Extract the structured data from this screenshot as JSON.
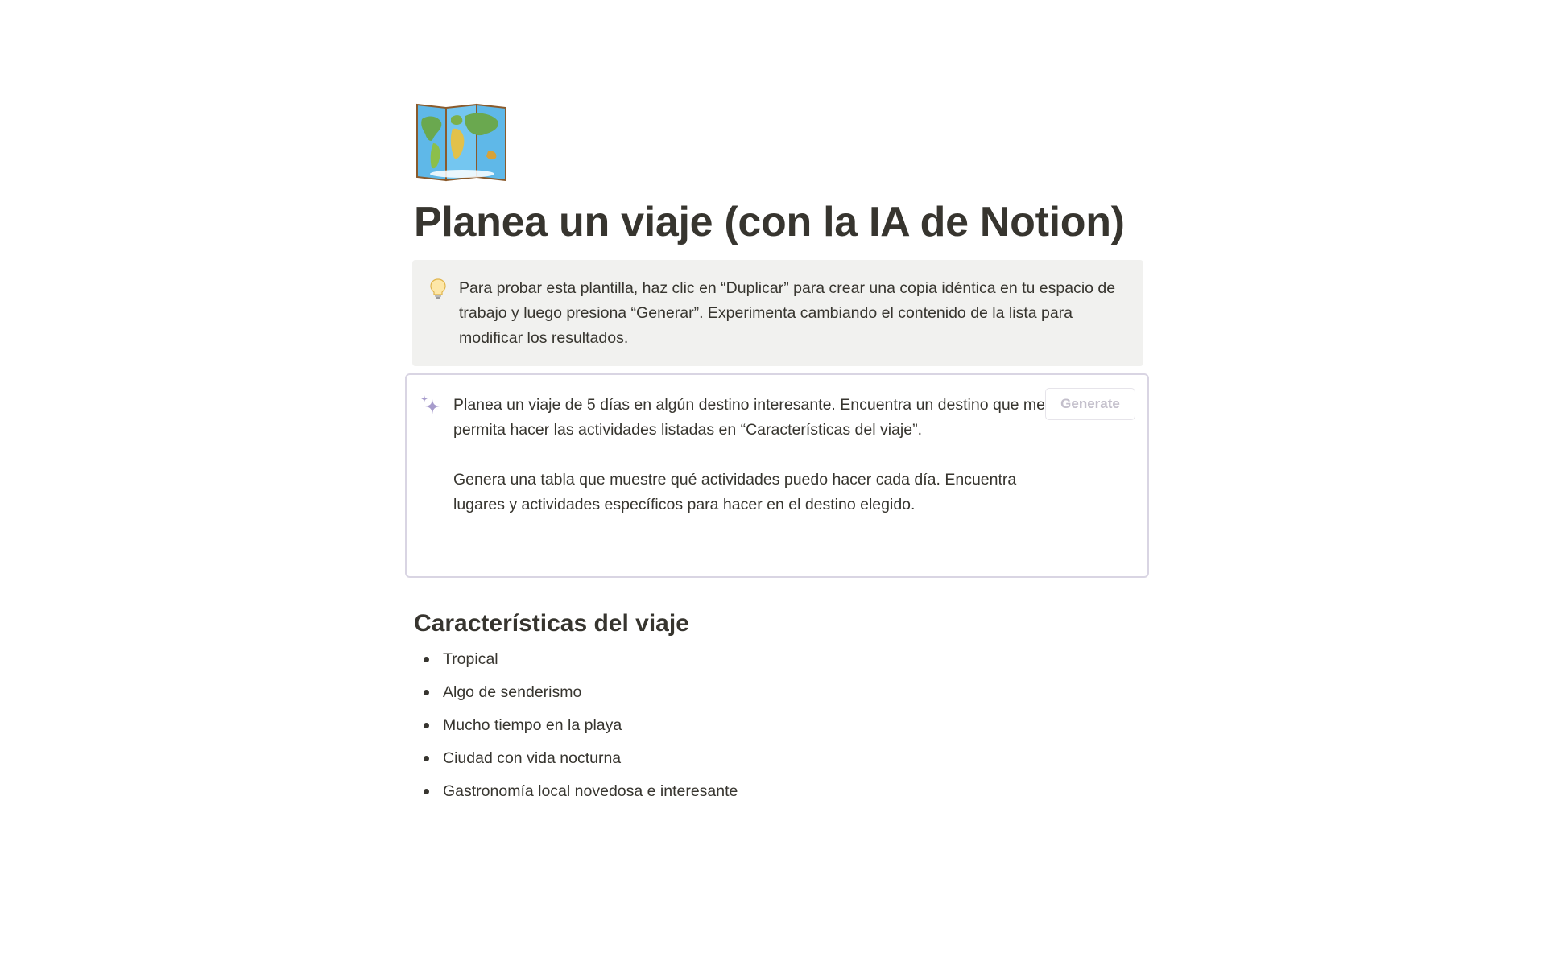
{
  "page": {
    "icon": "world-map-icon",
    "title": "Planea un viaje (con la IA de Notion)"
  },
  "callout": {
    "icon": "lightbulb-icon",
    "text": "Para probar esta plantilla, haz clic en “Duplicar” para crear una copia idéntica en tu espacio de trabajo y luego presiona “Generar”. Experimenta cambiando el contenido de la lista para modificar los resultados."
  },
  "ai_block": {
    "icon": "sparkle-icon",
    "prompt": "Planea un viaje de 5 días en algún destino interesante. Encuentra un destino que me permita hacer las actividades listadas en “Características del viaje”.\n\nGenera una tabla que muestre qué actividades puedo hacer cada día. Encuentra lugares y actividades específicos para hacer en el destino elegido.",
    "generate_label": "Generate"
  },
  "features": {
    "heading": "Características del viaje",
    "items": [
      "Tropical",
      "Algo de senderismo",
      "Mucho tiempo en la playa",
      "Ciudad con vida nocturna",
      "Gastronomía local novedosa e interesante"
    ]
  },
  "colors": {
    "text": "#37352f",
    "callout_bg": "#f1f1ef",
    "ai_border": "#d9d5e3",
    "ai_accent": "#a79ccc",
    "button_text": "#c3bfcb"
  }
}
